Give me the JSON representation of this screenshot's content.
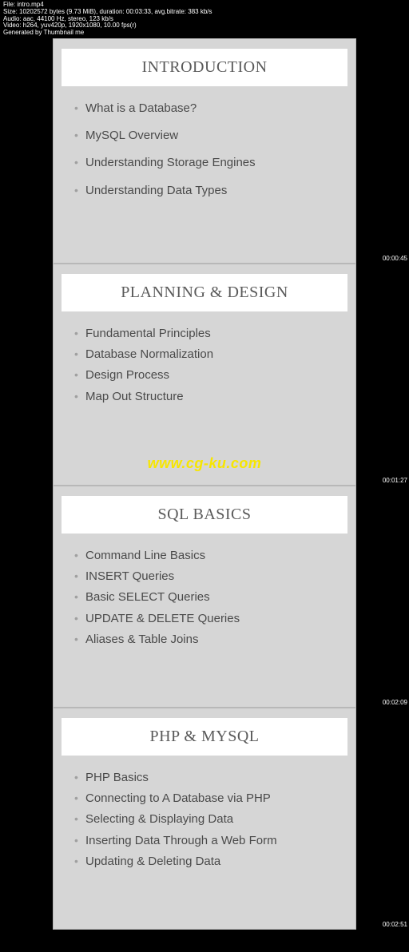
{
  "meta": {
    "line1": "File: intro.mp4",
    "line2": "Size: 10202572 bytes (9.73 MiB), duration: 00:03:33, avg.bitrate: 383 kb/s",
    "line3": "Audio: aac, 44100 Hz, stereo, 123 kb/s",
    "line4": "Video: h264, yuv420p, 1920x1080, 10.00 fps(r)",
    "line5": "Generated by Thumbnail me"
  },
  "watermark": "www.cg-ku.com",
  "slides": [
    {
      "title": "INTRODUCTION",
      "items": [
        "What is a Database?",
        "MySQL Overview",
        "Understanding Storage Engines",
        "Understanding Data Types"
      ],
      "timestamp": "00:00:45"
    },
    {
      "title": "PLANNING & DESIGN",
      "items": [
        "Fundamental Principles",
        "Database Normalization",
        "Design Process",
        "Map Out Structure"
      ],
      "timestamp": "00:01:27"
    },
    {
      "title": "SQL BASICS",
      "items": [
        "Command Line Basics",
        "INSERT Queries",
        "Basic SELECT Queries",
        "UPDATE & DELETE Queries",
        "Aliases & Table Joins"
      ],
      "timestamp": "00:02:09"
    },
    {
      "title": "PHP & MYSQL",
      "items": [
        "PHP Basics",
        "Connecting to A Database via PHP",
        "Selecting & Displaying Data",
        "Inserting Data Through a Web Form",
        "Updating & Deleting Data"
      ],
      "timestamp": "00:02:51"
    }
  ]
}
